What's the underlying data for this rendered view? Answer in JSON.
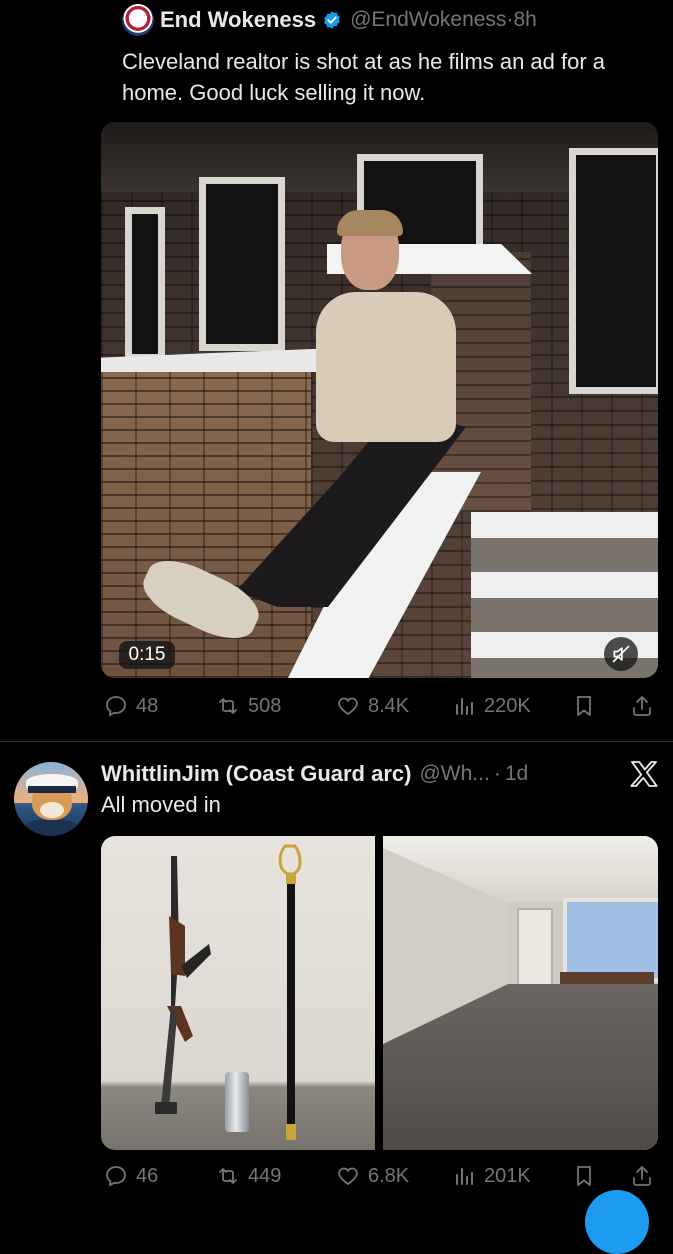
{
  "post1": {
    "display_name": "End Wokeness",
    "handle": "@EndWokeness",
    "separator": "·",
    "time": "8h",
    "text": "Cleveland realtor is shot at as he films an ad for a home. Good luck selling it now.",
    "video_time": "0:15",
    "replies": "48",
    "reposts": "508",
    "likes": "8.4K",
    "views": "220K"
  },
  "post2": {
    "display_name": "WhittlinJim (Coast Guard arc)",
    "handle": "@Wh...",
    "separator": "·",
    "time": "1d",
    "text": "All moved in",
    "replies": "46",
    "reposts": "449",
    "likes": "6.8K",
    "views": "201K"
  },
  "icons": {
    "reply": "reply-icon",
    "repost": "repost-icon",
    "like": "heart-icon",
    "views": "views-icon",
    "bookmark": "bookmark-icon",
    "share": "share-icon",
    "mute": "muted-speaker-icon",
    "platform": "x-logo-icon",
    "verified": "verified-badge-icon"
  },
  "colors": {
    "background": "#000000",
    "text_primary": "#e7e9ea",
    "text_secondary": "#71767b",
    "verified_blue": "#1d9bf0",
    "divider": "#2f3336"
  }
}
